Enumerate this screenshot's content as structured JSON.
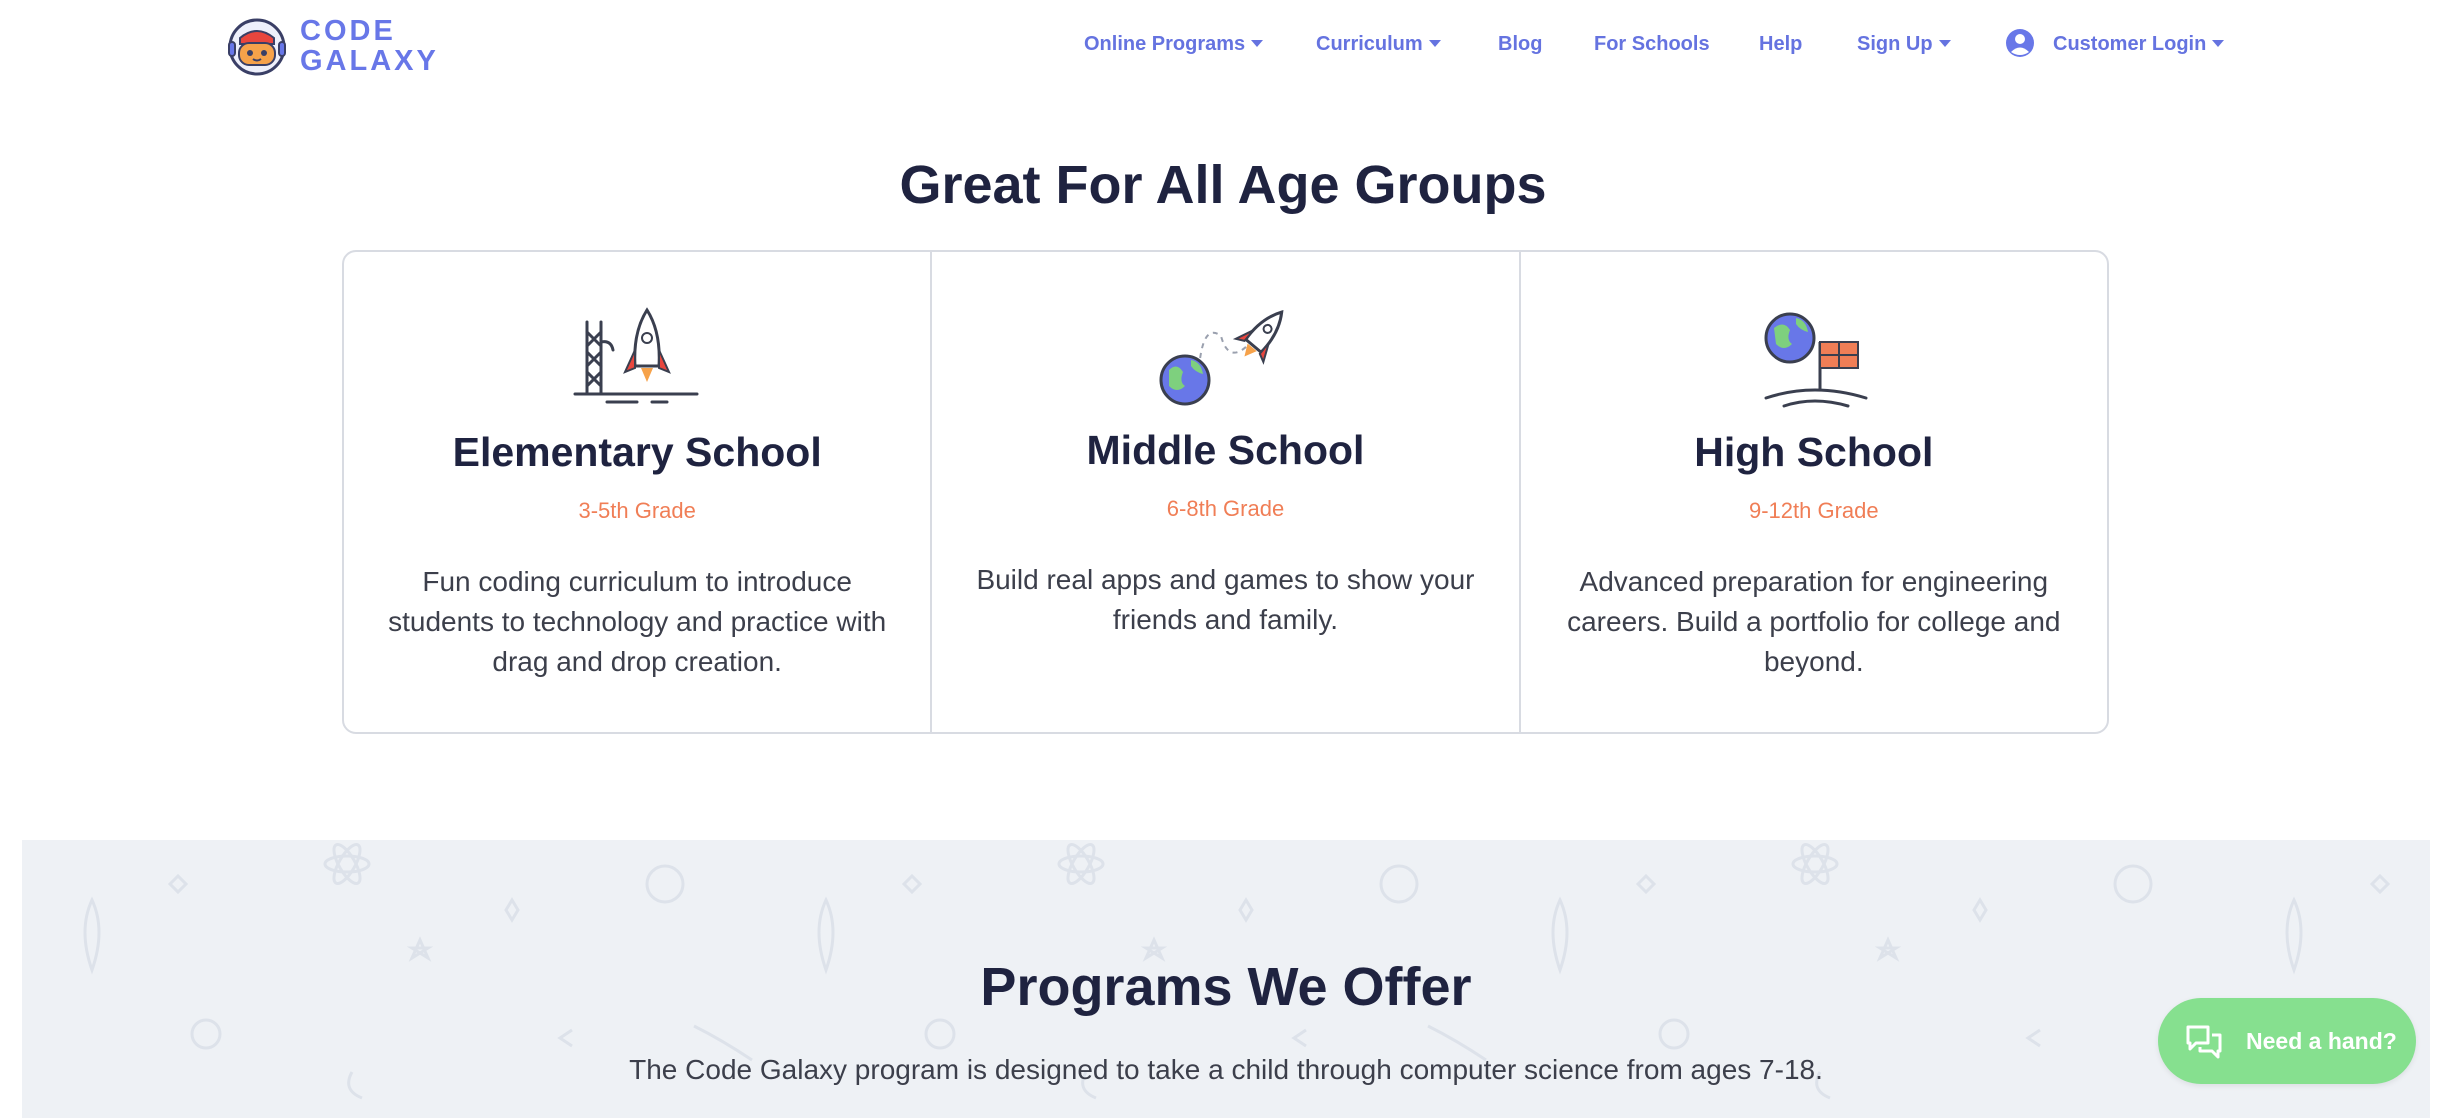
{
  "header": {
    "logo_line1": "CODE",
    "logo_line2": "GALAXY",
    "nav": [
      {
        "label": "Online Programs",
        "has_dropdown": true
      },
      {
        "label": "Curriculum",
        "has_dropdown": true
      },
      {
        "label": "Blog",
        "has_dropdown": false
      },
      {
        "label": "For Schools",
        "has_dropdown": false
      },
      {
        "label": "Help",
        "has_dropdown": false
      },
      {
        "label": "Sign Up",
        "has_dropdown": true
      },
      {
        "label": "Customer Login",
        "has_dropdown": true,
        "icon": "user-circle-icon"
      }
    ]
  },
  "age_groups": {
    "title": "Great For All Age Groups",
    "cards": [
      {
        "icon": "rocket-launch-icon",
        "title": "Elementary School",
        "grade": "3-5th Grade",
        "description": "Fun coding curriculum to introduce students to technology and practice with drag and drop creation."
      },
      {
        "icon": "earth-rocket-icon",
        "title": "Middle School",
        "grade": "6-8th Grade",
        "description": "Build real apps and games to show your friends and family."
      },
      {
        "icon": "earth-flag-icon",
        "title": "High School",
        "grade": "9-12th Grade",
        "description": "Advanced preparation for engineering careers. Build a portfolio for college and beyond."
      }
    ]
  },
  "programs": {
    "title": "Programs We Offer",
    "subtitle": "The Code Galaxy program is designed to take a child through computer science from ages 7-18."
  },
  "help_widget": {
    "label": "Need a hand?",
    "icon": "chat-bubbles-icon"
  },
  "colors": {
    "brand_blue": "#6877e8",
    "heading_navy": "#1f2340",
    "grade_orange": "#f07e56",
    "help_green": "#86e08f",
    "programs_bg": "#eef1f5"
  }
}
